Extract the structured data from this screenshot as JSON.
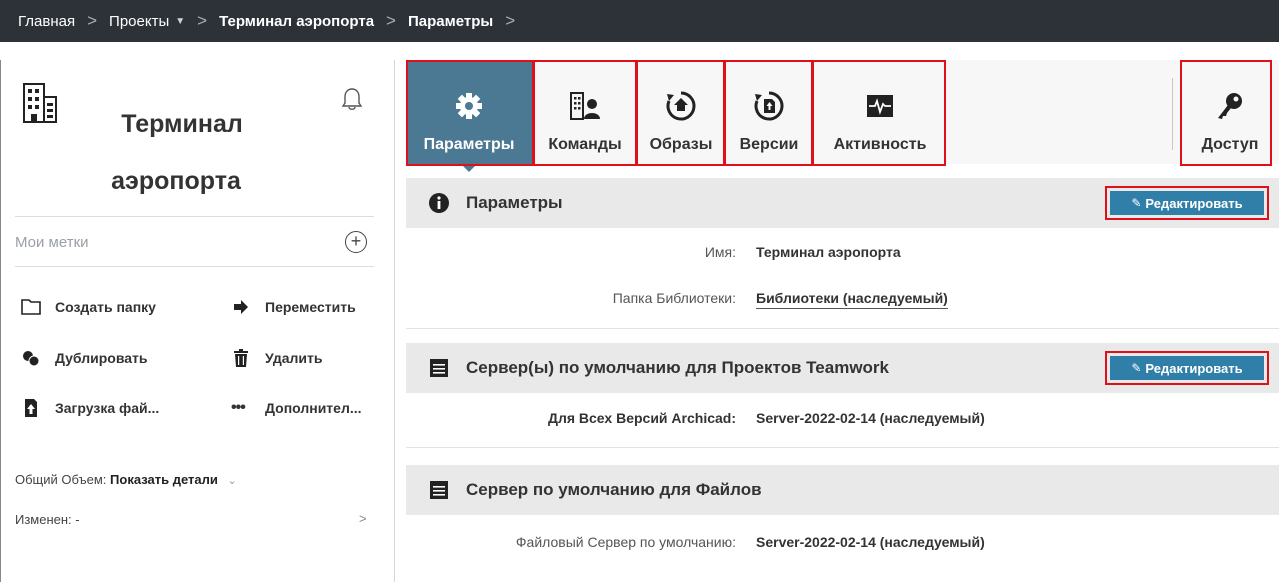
{
  "breadcrumb": {
    "home": "Главная",
    "projects": "Проекты",
    "project": "Терминал аэропорта",
    "current": "Параметры"
  },
  "left": {
    "title_line1": "Терминал",
    "title_line2": "аэропорта",
    "tags_label": "Мои метки",
    "actions": {
      "create_folder": "Создать папку",
      "move": "Переместить",
      "duplicate": "Дублировать",
      "delete": "Удалить",
      "upload": "Загрузка фай...",
      "more": "Дополнител..."
    },
    "volume_label": "Общий Объем:",
    "volume_link": "Показать детали",
    "changed": "Изменен: -"
  },
  "tabs": {
    "params": "Параметры",
    "teams": "Команды",
    "images": "Образы",
    "versions": "Версии",
    "activity": "Активность",
    "access": "Доступ"
  },
  "sections": {
    "params": {
      "title": "Параметры",
      "edit": "Редактировать",
      "name_label": "Имя:",
      "name_value": "Терминал аэропорта",
      "library_label": "Папка Библиотеки:",
      "library_value": "Библиотеки (наследуемый)"
    },
    "servers": {
      "title": "Сервер(ы) по умолчанию для Проектов Teamwork",
      "edit": "Редактировать",
      "all_versions_label": "Для Всех Версий Archicad:",
      "all_versions_value": "Server-2022-02-14 (наследуемый)"
    },
    "file_server": {
      "title": "Сервер по умолчанию для Файлов",
      "default_label": "Файловый Сервер по умолчанию:",
      "default_value": "Server-2022-02-14 (наследуемый)"
    }
  },
  "colors": {
    "topbar": "#2c3238",
    "active_tab": "#4b7892",
    "edit_button": "#2f7fa8",
    "highlight": "#e0101a"
  }
}
